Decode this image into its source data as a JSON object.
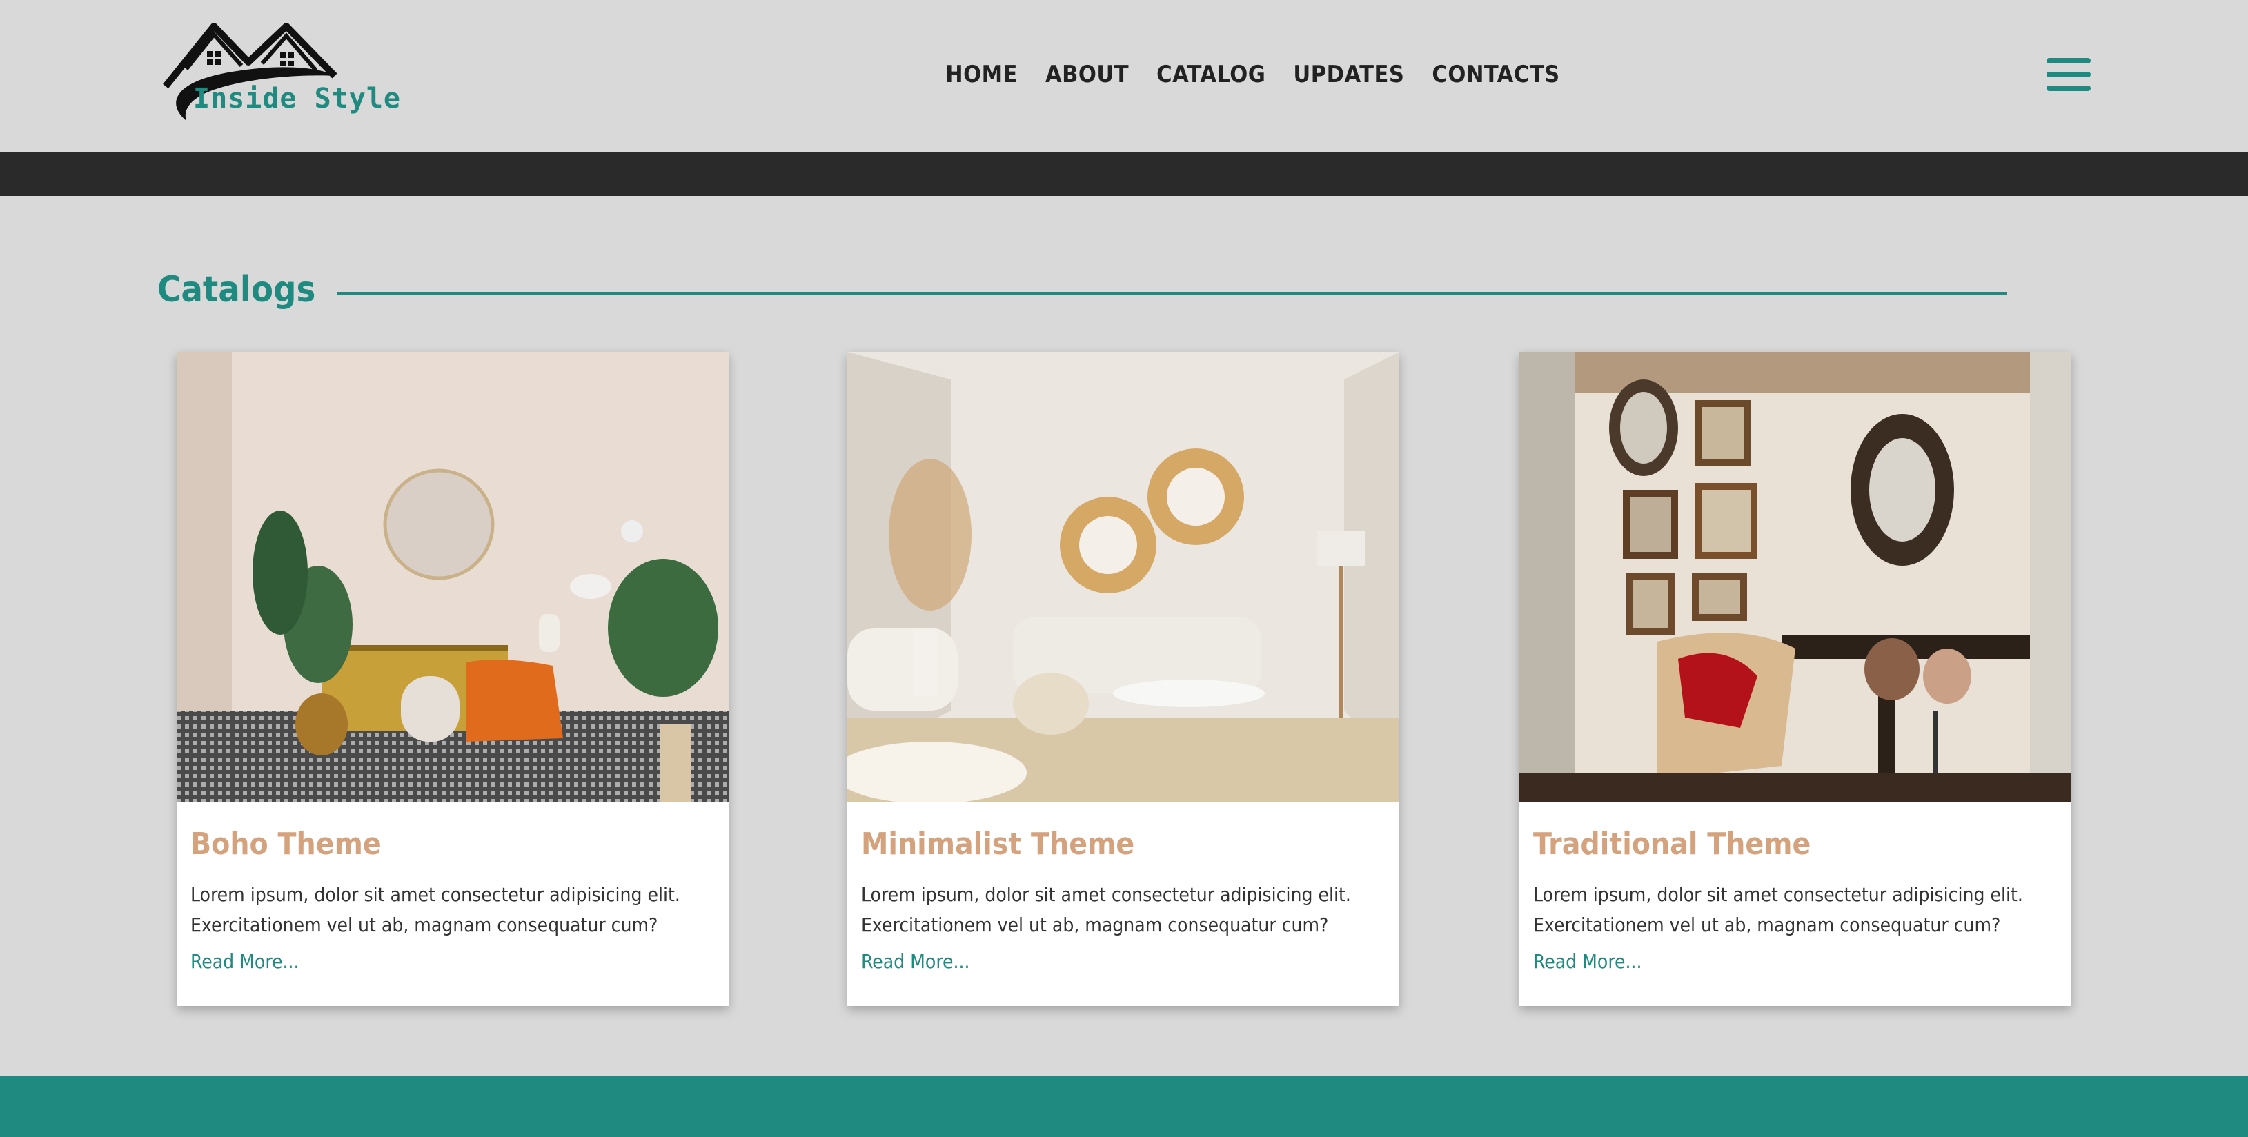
{
  "header": {
    "logo_text": "Inside Style",
    "nav": [
      "HOME",
      "ABOUT",
      "CATALOG",
      "UPDATES",
      "CONTACTS"
    ]
  },
  "section": {
    "title": "Catalogs"
  },
  "cards": [
    {
      "title": "Boho Theme",
      "text_line1": "Lorem ipsum, dolor sit amet consectetur adipisicing elit.",
      "text_line2": "Exercitationem vel ut ab, magnam consequatur cum?",
      "link": "Read More..."
    },
    {
      "title": "Minimalist Theme",
      "text_line1": "Lorem ipsum, dolor sit amet consectetur adipisicing elit.",
      "text_line2": "Exercitationem vel ut ab, magnam consequatur cum?",
      "link": "Read More..."
    },
    {
      "title": "Traditional Theme",
      "text_line1": "Lorem ipsum, dolor sit amet consectetur adipisicing elit.",
      "text_line2": "Exercitationem vel ut ab, magnam consequatur cum?",
      "link": "Read More..."
    }
  ],
  "colors": {
    "accent": "#1e8a80",
    "card_title": "#d4a27c",
    "background": "#d9d9d9",
    "dark_band": "#2a2a2a"
  },
  "icons": {
    "menu": "hamburger-menu-icon",
    "logo": "house-roof-logo"
  }
}
